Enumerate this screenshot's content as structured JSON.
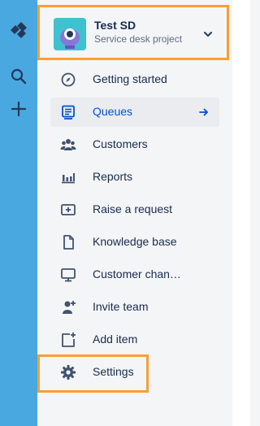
{
  "global_nav": {
    "icons": [
      "jira-logo-icon",
      "search-icon",
      "plus-icon"
    ]
  },
  "project": {
    "name": "Test SD",
    "type": "Service desk project",
    "avatar": "project-avatar-icon"
  },
  "nav": {
    "items": [
      {
        "label": "Getting started",
        "icon": "compass-icon"
      },
      {
        "label": "Queues",
        "icon": "queues-icon",
        "active": true
      },
      {
        "label": "Customers",
        "icon": "people-icon"
      },
      {
        "label": "Reports",
        "icon": "reports-icon"
      },
      {
        "label": "Raise a request",
        "icon": "raise-request-icon"
      },
      {
        "label": "Knowledge base",
        "icon": "page-icon"
      },
      {
        "label": "Customer chan…",
        "icon": "monitor-icon"
      },
      {
        "label": "Invite team",
        "icon": "invite-person-icon"
      },
      {
        "label": "Add item",
        "icon": "add-item-icon"
      },
      {
        "label": "Settings",
        "icon": "gear-icon"
      }
    ]
  },
  "colors": {
    "global_nav_bg": "#4aa8e0",
    "sidebar_bg": "#f4f5f7",
    "highlight": "#f7a033",
    "active_text": "#0052cc",
    "text": "#172b4d"
  }
}
